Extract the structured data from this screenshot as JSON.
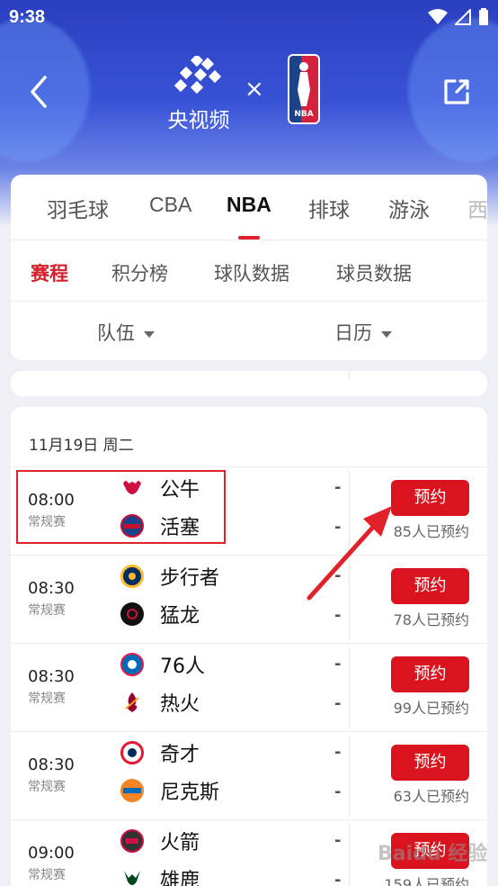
{
  "status": {
    "time": "9:38"
  },
  "header": {
    "brand": "央视频",
    "times": "×",
    "partner": "NBA"
  },
  "sport_tabs": [
    {
      "label": "羽毛球"
    },
    {
      "label": "CBA"
    },
    {
      "label": "NBA"
    },
    {
      "label": "排球"
    },
    {
      "label": "游泳"
    },
    {
      "label": "西"
    }
  ],
  "sub_tabs": [
    {
      "label": "赛程"
    },
    {
      "label": "积分榜"
    },
    {
      "label": "球队数据"
    },
    {
      "label": "球员数据"
    }
  ],
  "filters": {
    "team": "队伍",
    "calendar": "日历"
  },
  "schedule": {
    "date": "11月19日 周二",
    "matches": [
      {
        "time": "08:00",
        "type": "常规赛",
        "home": "公牛",
        "away": "活塞",
        "home_score": "-",
        "away_score": "-",
        "button": "预约",
        "count": "85人已预约"
      },
      {
        "time": "08:30",
        "type": "常规赛",
        "home": "步行者",
        "away": "猛龙",
        "home_score": "-",
        "away_score": "-",
        "button": "预约",
        "count": "78人已预约"
      },
      {
        "time": "08:30",
        "type": "常规赛",
        "home": "76人",
        "away": "热火",
        "home_score": "-",
        "away_score": "-",
        "button": "预约",
        "count": "99人已预约"
      },
      {
        "time": "08:30",
        "type": "常规赛",
        "home": "奇才",
        "away": "尼克斯",
        "home_score": "-",
        "away_score": "-",
        "button": "预约",
        "count": "63人已预约"
      },
      {
        "time": "09:00",
        "type": "常规赛",
        "home": "火箭",
        "away": "雄鹿",
        "home_score": "-",
        "away_score": "-",
        "button": "预约",
        "count": "159人已预约"
      }
    ]
  },
  "colors": {
    "accent": "#d9141f",
    "header_blue": "#3852d6"
  },
  "watermark": "Baidu 经验"
}
